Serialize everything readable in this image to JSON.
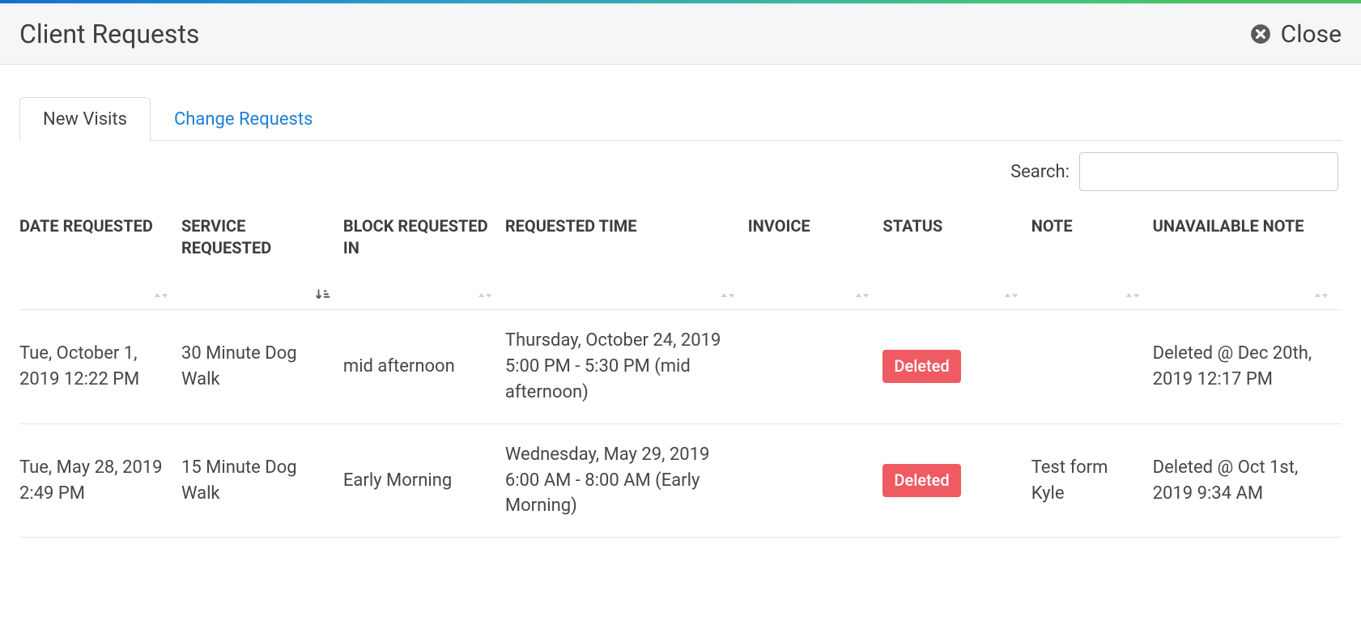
{
  "header": {
    "title": "Client Requests",
    "close_label": "Close"
  },
  "tabs": [
    {
      "label": "New Visits",
      "active": true
    },
    {
      "label": "Change Requests",
      "active": false
    }
  ],
  "search": {
    "label": "Search:",
    "value": ""
  },
  "table": {
    "columns": [
      {
        "label": "DATE REQUESTED",
        "sort": "none"
      },
      {
        "label": "SERVICE REQUESTED",
        "sort": "asc_active"
      },
      {
        "label": "BLOCK REQUESTED IN",
        "sort": "none"
      },
      {
        "label": "REQUESTED TIME",
        "sort": "none"
      },
      {
        "label": "INVOICE",
        "sort": "none"
      },
      {
        "label": "STATUS",
        "sort": "none"
      },
      {
        "label": "NOTE",
        "sort": "none"
      },
      {
        "label": "UNAVAILABLE NOTE",
        "sort": "none"
      }
    ],
    "rows": [
      {
        "date_requested": "Tue, October 1, 2019 12:22 PM",
        "service_requested": "30 Minute Dog Walk",
        "block": "mid afternoon",
        "requested_time": "Thursday, October 24, 2019 5:00 PM - 5:30 PM (mid afternoon)",
        "invoice": "",
        "status": "Deleted",
        "status_kind": "deleted",
        "note": "",
        "unavailable_note": "Deleted @ Dec 20th, 2019 12:17 PM"
      },
      {
        "date_requested": "Tue, May 28, 2019 2:49 PM",
        "service_requested": "15 Minute Dog Walk",
        "block": "Early Morning",
        "requested_time": "Wednesday, May 29, 2019 6:00 AM - 8:00 AM (Early Morning)",
        "invoice": "",
        "status": "Deleted",
        "status_kind": "deleted",
        "note": "Test form Kyle",
        "unavailable_note": "Deleted @ Oct 1st, 2019 9:34 AM"
      }
    ]
  }
}
